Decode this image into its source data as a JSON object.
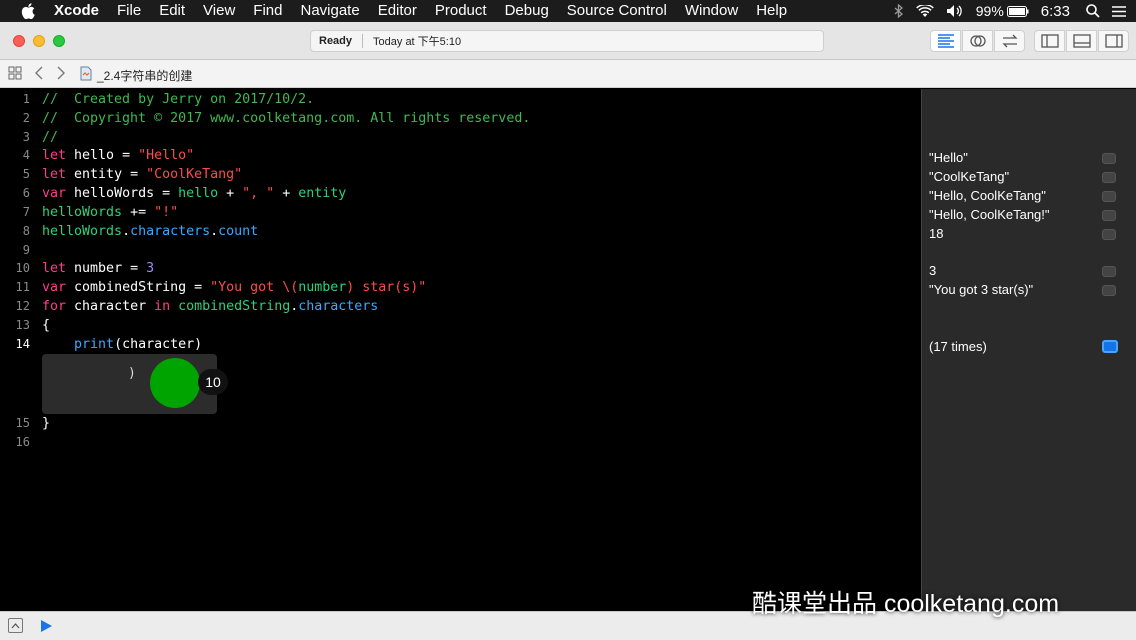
{
  "menubar": {
    "app": "Xcode",
    "items": [
      "File",
      "Edit",
      "View",
      "Find",
      "Navigate",
      "Editor",
      "Product",
      "Debug",
      "Source Control",
      "Window",
      "Help"
    ],
    "battery": "99%",
    "clock": "6:33"
  },
  "toolbar": {
    "status_label": "Ready",
    "status_time": "Today at 下午5:10"
  },
  "jumpbar": {
    "file_name": "_2.4字符串的创建"
  },
  "editor": {
    "lines": [
      {
        "num": "1",
        "tokens": [
          {
            "t": "//  Created by Jerry on 2017/10/2.",
            "c": "com"
          }
        ]
      },
      {
        "num": "2",
        "tokens": [
          {
            "t": "//  Copyright © 2017 www.coolketang.com. All rights reserved.",
            "c": "com"
          }
        ]
      },
      {
        "num": "3",
        "tokens": [
          {
            "t": "//",
            "c": "com"
          }
        ]
      },
      {
        "num": "4",
        "tokens": [
          {
            "t": "let",
            "c": "kw"
          },
          {
            "t": " hello = ",
            "c": "plain"
          },
          {
            "t": "\"Hello\"",
            "c": "str"
          }
        ]
      },
      {
        "num": "5",
        "tokens": [
          {
            "t": "let",
            "c": "kw"
          },
          {
            "t": " entity = ",
            "c": "plain"
          },
          {
            "t": "\"CoolKeTang\"",
            "c": "str"
          }
        ]
      },
      {
        "num": "6",
        "tokens": [
          {
            "t": "var",
            "c": "kw"
          },
          {
            "t": " helloWords = ",
            "c": "plain"
          },
          {
            "t": "hello",
            "c": "fn"
          },
          {
            "t": " + ",
            "c": "plain"
          },
          {
            "t": "\", \"",
            "c": "str"
          },
          {
            "t": " + ",
            "c": "plain"
          },
          {
            "t": "entity",
            "c": "fn"
          }
        ]
      },
      {
        "num": "7",
        "tokens": [
          {
            "t": "helloWords",
            "c": "fn"
          },
          {
            "t": " += ",
            "c": "plain"
          },
          {
            "t": "\"!\"",
            "c": "str"
          }
        ]
      },
      {
        "num": "8",
        "tokens": [
          {
            "t": "helloWords",
            "c": "fn"
          },
          {
            "t": ".",
            "c": "plain"
          },
          {
            "t": "characters",
            "c": "prop"
          },
          {
            "t": ".",
            "c": "plain"
          },
          {
            "t": "count",
            "c": "prop"
          }
        ]
      },
      {
        "num": "9",
        "tokens": []
      },
      {
        "num": "10",
        "tokens": [
          {
            "t": "let",
            "c": "kw"
          },
          {
            "t": " number = ",
            "c": "plain"
          },
          {
            "t": "3",
            "c": "num"
          }
        ]
      },
      {
        "num": "11",
        "tokens": [
          {
            "t": "var",
            "c": "kw"
          },
          {
            "t": " combinedString = ",
            "c": "plain"
          },
          {
            "t": "\"You got \\(",
            "c": "str"
          },
          {
            "t": "number",
            "c": "fn"
          },
          {
            "t": ") star(s)\"",
            "c": "str"
          }
        ]
      },
      {
        "num": "12",
        "tokens": [
          {
            "t": "for",
            "c": "kw"
          },
          {
            "t": " character ",
            "c": "plain"
          },
          {
            "t": "in",
            "c": "kw"
          },
          {
            "t": " ",
            "c": "plain"
          },
          {
            "t": "combinedString",
            "c": "fn"
          },
          {
            "t": ".",
            "c": "plain"
          },
          {
            "t": "characters",
            "c": "prop"
          }
        ]
      },
      {
        "num": "13",
        "tokens": [
          {
            "t": "{",
            "c": "plain"
          }
        ]
      },
      {
        "num": "14",
        "tokens": [
          {
            "t": "    ",
            "c": "plain"
          },
          {
            "t": "print",
            "c": "prop"
          },
          {
            "t": "(character)",
            "c": "plain"
          }
        ]
      },
      {
        "num": "15",
        "tokens": [
          {
            "t": "}",
            "c": "plain"
          }
        ]
      },
      {
        "num": "16",
        "tokens": []
      }
    ],
    "inline_result": {
      "text": ")",
      "badge": "10"
    }
  },
  "results": [
    {
      "text": "\"Hello\"",
      "line": "4"
    },
    {
      "text": "\"CoolKeTang\"",
      "line": "5"
    },
    {
      "text": "\"Hello, CoolKeTang\"",
      "line": "6"
    },
    {
      "text": "\"Hello, CoolKeTang!\"",
      "line": "7"
    },
    {
      "text": "18",
      "line": "8"
    },
    {
      "text": "3",
      "line": "10"
    },
    {
      "text": "\"You got 3 star(s)\"",
      "line": "11"
    },
    {
      "text": "(17 times)",
      "line": "14"
    }
  ],
  "watermark": "酷课堂出品 coolketang.com",
  "colors": {
    "accent": "#1473e6",
    "comment": "#3fb950",
    "keyword": "#fc3f8c",
    "string": "#fc4b4b"
  }
}
